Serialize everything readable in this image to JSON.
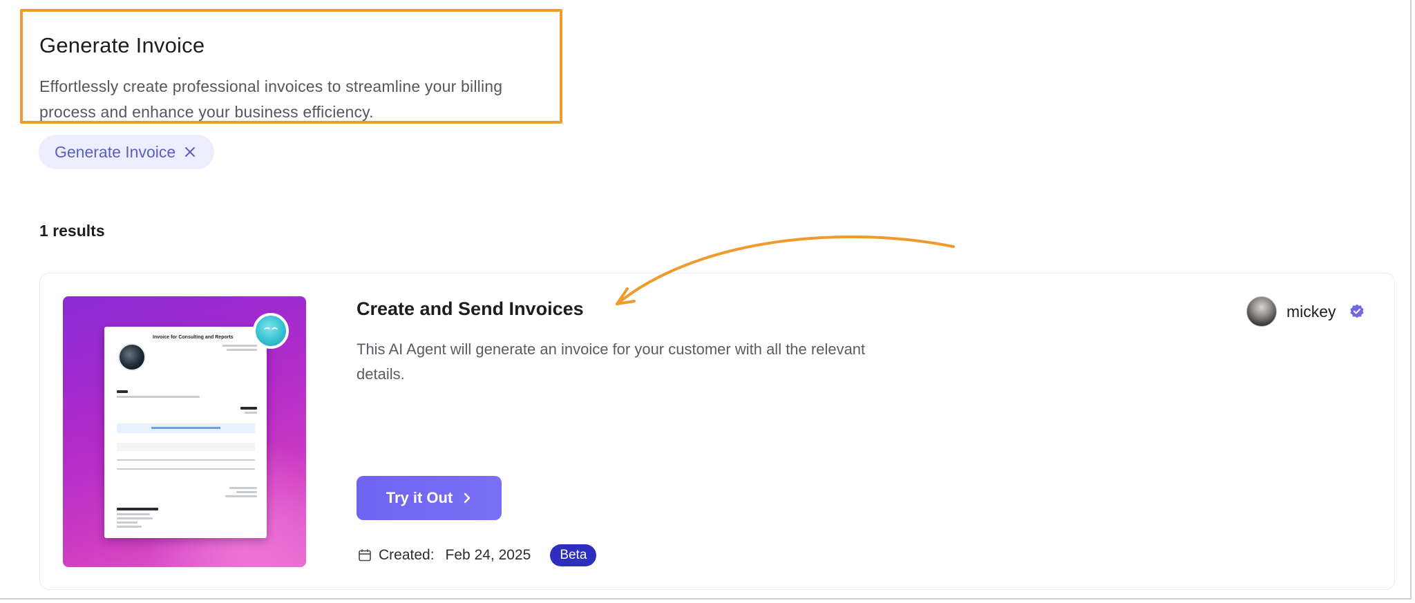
{
  "header": {
    "title": "Generate Invoice",
    "description": "Effortlessly create professional invoices to streamline your billing process and enhance your business efficiency."
  },
  "filter_chip": {
    "label": "Generate Invoice",
    "icon": "close-icon"
  },
  "results": {
    "count_label": "1 results"
  },
  "card": {
    "thumbnail_invoice_title": "Invoice for Consulting and Reports",
    "title": "Create and Send Invoices",
    "description": "This AI Agent will generate an invoice for your customer with all the relevant details.",
    "button_label": "Try it Out",
    "created_label": "Created:",
    "created_date": "Feb 24, 2025",
    "badge": "Beta",
    "author_name": "mickey"
  },
  "colors": {
    "highlight": "#ef9a2a",
    "chip_bg": "#eceefe",
    "chip_text": "#5c5fbe",
    "button": "#7367f3",
    "badge": "#2f2fbf",
    "verified": "#6f67e6"
  }
}
